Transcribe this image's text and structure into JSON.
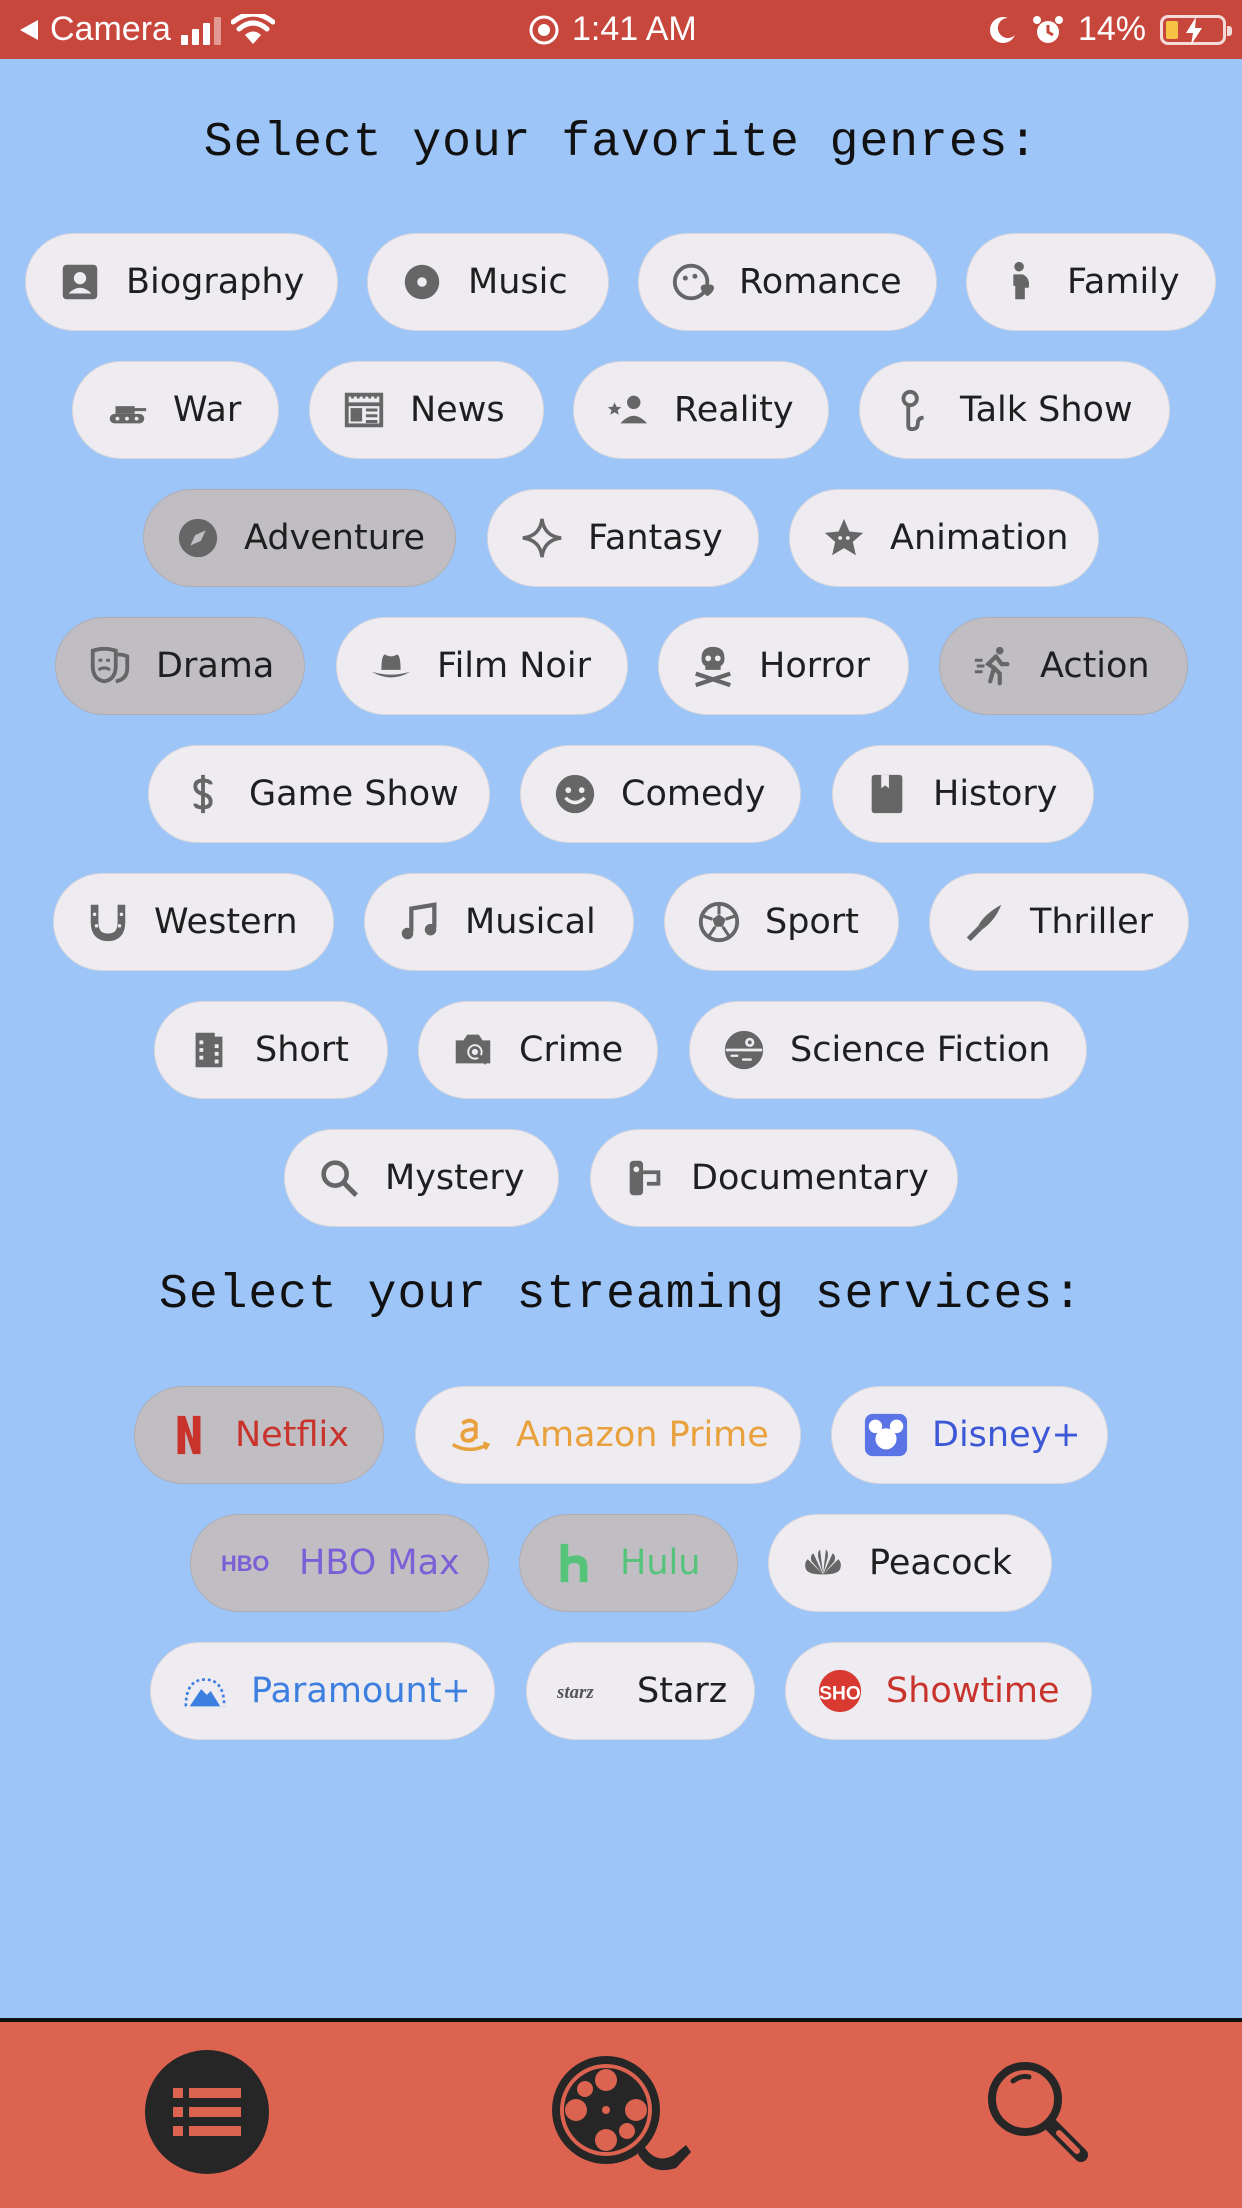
{
  "status_bar": {
    "back_label": "Camera",
    "time": "1:41 AM",
    "battery": "14%"
  },
  "headings": {
    "genres": "Select your favorite genres:",
    "services": "Select your streaming services:"
  },
  "genres": [
    {
      "label": "Biography",
      "icon": "contact-card-icon",
      "selected": false
    },
    {
      "label": "Music",
      "icon": "disc-icon",
      "selected": false
    },
    {
      "label": "Romance",
      "icon": "face-heart-icon",
      "selected": false
    },
    {
      "label": "Family",
      "icon": "pregnant-person-icon",
      "selected": false
    },
    {
      "label": "War",
      "icon": "tank-icon",
      "selected": false
    },
    {
      "label": "News",
      "icon": "newspaper-icon",
      "selected": false
    },
    {
      "label": "Reality",
      "icon": "person-star-icon",
      "selected": false
    },
    {
      "label": "Talk Show",
      "icon": "microphone-icon",
      "selected": false
    },
    {
      "label": "Adventure",
      "icon": "compass-icon",
      "selected": true
    },
    {
      "label": "Fantasy",
      "icon": "sparkle-icon",
      "selected": false
    },
    {
      "label": "Animation",
      "icon": "star-face-icon",
      "selected": false
    },
    {
      "label": "Drama",
      "icon": "theater-mask-icon",
      "selected": true
    },
    {
      "label": "Film Noir",
      "icon": "fedora-hat-icon",
      "selected": false
    },
    {
      "label": "Horror",
      "icon": "skull-crossbones-icon",
      "selected": false
    },
    {
      "label": "Action",
      "icon": "running-person-icon",
      "selected": true
    },
    {
      "label": "Game Show",
      "icon": "dollar-icon",
      "selected": false
    },
    {
      "label": "Comedy",
      "icon": "smiley-icon",
      "selected": false
    },
    {
      "label": "History",
      "icon": "book-icon",
      "selected": false
    },
    {
      "label": "Western",
      "icon": "horseshoe-icon",
      "selected": false
    },
    {
      "label": "Musical",
      "icon": "music-note-icon",
      "selected": false
    },
    {
      "label": "Sport",
      "icon": "soccer-ball-icon",
      "selected": false
    },
    {
      "label": "Thriller",
      "icon": "knife-icon",
      "selected": false
    },
    {
      "label": "Short",
      "icon": "film-strip-icon",
      "selected": false
    },
    {
      "label": "Crime",
      "icon": "camera-search-icon",
      "selected": false
    },
    {
      "label": "Science Fiction",
      "icon": "death-star-icon",
      "selected": false
    },
    {
      "label": "Mystery",
      "icon": "magnifier-icon",
      "selected": false
    },
    {
      "label": "Documentary",
      "icon": "video-camera-icon",
      "selected": false
    }
  ],
  "services": [
    {
      "label": "Netflix",
      "logo": "netflix-logo-icon",
      "color": "#c8342c",
      "selected": true
    },
    {
      "label": "Amazon Prime",
      "logo": "amazon-logo-icon",
      "color": "#e8a13c",
      "selected": false
    },
    {
      "label": "Disney+",
      "logo": "disney-logo-icon",
      "color": "#3d58d6",
      "selected": false
    },
    {
      "label": "HBO Max",
      "logo": "hbo-logo-icon",
      "color": "#7b5fd6",
      "selected": true
    },
    {
      "label": "Hulu",
      "logo": "hulu-logo-icon",
      "color": "#56c37a",
      "selected": true
    },
    {
      "label": "Peacock",
      "logo": "peacock-logo-icon",
      "color": "#1f1f1f",
      "selected": false
    },
    {
      "label": "Paramount+",
      "logo": "paramount-logo-icon",
      "color": "#3c7fe0",
      "selected": false
    },
    {
      "label": "Starz",
      "logo": "starz-logo-icon",
      "color": "#1f1f1f",
      "selected": false
    },
    {
      "label": "Showtime",
      "logo": "showtime-logo-icon",
      "color": "#c8342c",
      "selected": false
    }
  ],
  "logo_text": {
    "hbo": "HBO",
    "starz": "starz",
    "sho": "SHO"
  },
  "bottom_nav": {
    "items": [
      "list-icon",
      "film-reel-icon",
      "search-icon"
    ],
    "active": "list-icon"
  },
  "colors": {
    "background": "#9dc5f8",
    "status_bar": "#c8473d",
    "bottom_nav": "#dc6350",
    "chip": "#efecf1",
    "chip_selected": "#c1bec3"
  }
}
